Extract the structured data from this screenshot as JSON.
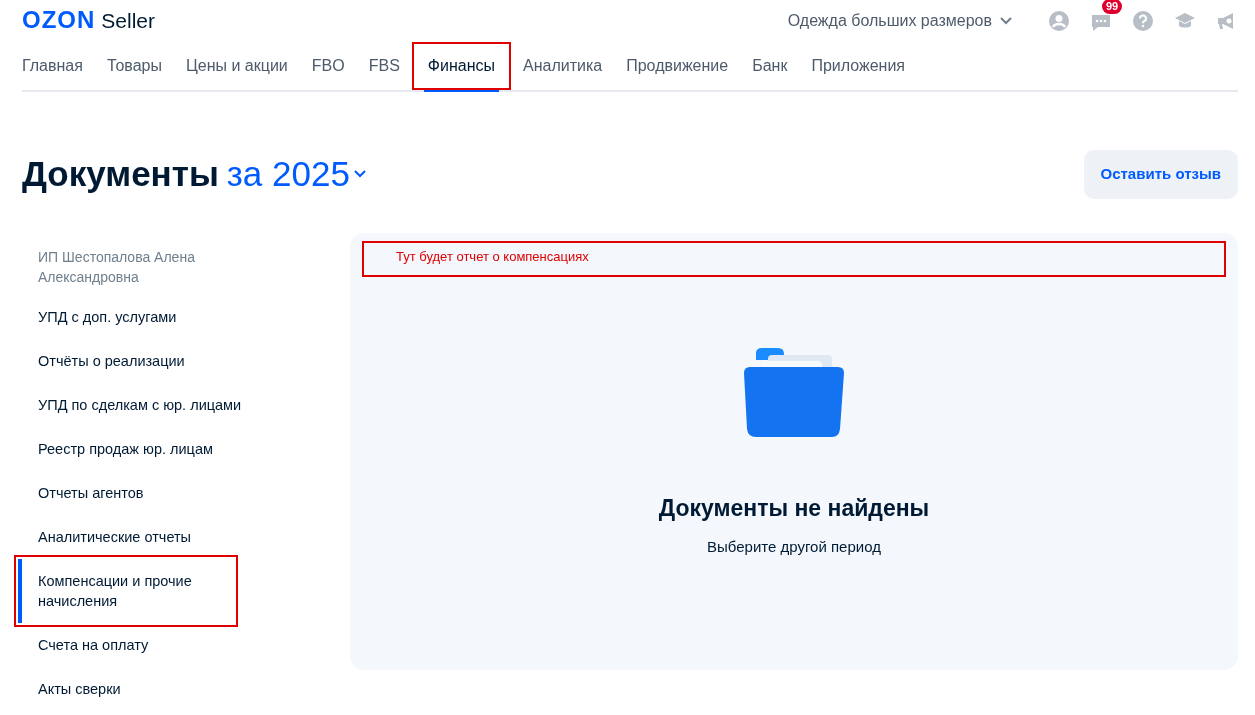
{
  "header": {
    "logo": "OZON",
    "logo_suffix": "Seller",
    "store": "Одежда больших размеров",
    "messages_badge": "99"
  },
  "tabs": [
    {
      "label": "Главная",
      "selected": false,
      "highlighted": false
    },
    {
      "label": "Товары",
      "selected": false,
      "highlighted": false
    },
    {
      "label": "Цены и акции",
      "selected": false,
      "highlighted": false
    },
    {
      "label": "FBO",
      "selected": false,
      "highlighted": false
    },
    {
      "label": "FBS",
      "selected": false,
      "highlighted": false
    },
    {
      "label": "Финансы",
      "selected": true,
      "highlighted": true
    },
    {
      "label": "Аналитика",
      "selected": false,
      "highlighted": false
    },
    {
      "label": "Продвижение",
      "selected": false,
      "highlighted": false
    },
    {
      "label": "Банк",
      "selected": false,
      "highlighted": false
    },
    {
      "label": "Приложения",
      "selected": false,
      "highlighted": false
    }
  ],
  "page": {
    "title": "Документы",
    "period": "за 2025",
    "feedback_button": "Оставить отзыв"
  },
  "sidebar": {
    "owner": "ИП Шестопалова Алена Александровна",
    "items": [
      {
        "label": "УПД с доп. услугами",
        "selected": false,
        "highlighted": false
      },
      {
        "label": "Отчёты о реализации",
        "selected": false,
        "highlighted": false
      },
      {
        "label": "УПД по сделкам с юр. лицами",
        "selected": false,
        "highlighted": false
      },
      {
        "label": "Реестр продаж юр. лицам",
        "selected": false,
        "highlighted": false
      },
      {
        "label": "Отчеты агентов",
        "selected": false,
        "highlighted": false
      },
      {
        "label": "Аналитические отчеты",
        "selected": false,
        "highlighted": false
      },
      {
        "label": "Компенсации и прочие начисления",
        "selected": true,
        "highlighted": true
      },
      {
        "label": "Счета на оплату",
        "selected": false,
        "highlighted": false
      },
      {
        "label": "Акты сверки",
        "selected": false,
        "highlighted": false
      }
    ]
  },
  "panel": {
    "annotation": "Тут будет отчет о компенсациях",
    "empty_title": "Документы не найдены",
    "empty_hint": "Выберите другой период"
  }
}
